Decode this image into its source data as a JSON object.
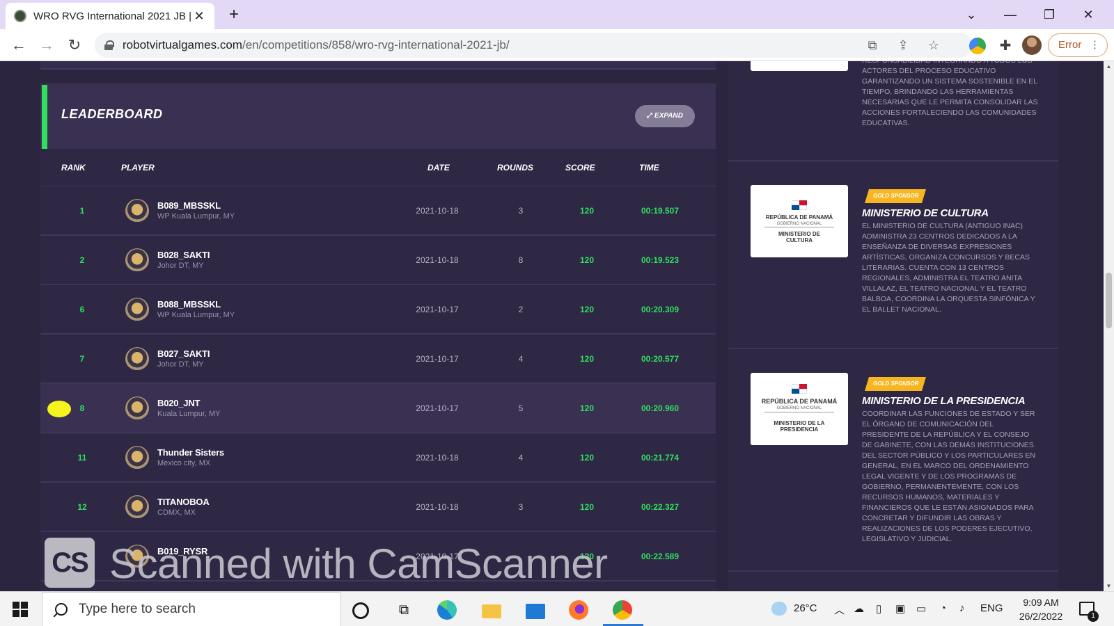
{
  "browser": {
    "tab_title": "WRO RVG International 2021 JB |",
    "tab_close": "✕",
    "new_tab": "+",
    "url_host": "robotvirtualgames.com",
    "url_path": "/en/competitions/858/wro-rvg-international-2021-jb/",
    "error_chip": "Error",
    "window_controls": [
      "⌄",
      "—",
      "❐",
      "✕"
    ]
  },
  "leaderboard": {
    "title": "LEADERBOARD",
    "expand_label": "EXPAND",
    "columns": {
      "rank": "RANK",
      "player": "PLAYER",
      "date": "DATE",
      "rounds": "ROUNDS",
      "score": "SCORE",
      "time": "TIME"
    },
    "rows": [
      {
        "rank": "1",
        "name": "B089_MBSSKL",
        "location": "WP Kuala Lumpur, MY",
        "date": "2021-10-18",
        "rounds": "3",
        "score": "120",
        "time": "00:19.507"
      },
      {
        "rank": "2",
        "name": "B028_SAKTI",
        "location": "Johor DT, MY",
        "date": "2021-10-18",
        "rounds": "8",
        "score": "120",
        "time": "00:19.523"
      },
      {
        "rank": "6",
        "name": "B088_MBSSKL",
        "location": "WP Kuala Lumpur, MY",
        "date": "2021-10-17",
        "rounds": "2",
        "score": "120",
        "time": "00:20.309"
      },
      {
        "rank": "7",
        "name": "B027_SAKTI",
        "location": "Johor DT, MY",
        "date": "2021-10-17",
        "rounds": "4",
        "score": "120",
        "time": "00:20.577"
      },
      {
        "rank": "8",
        "name": "B020_JNT",
        "location": "Kuala Lumpur, MY",
        "date": "2021-10-17",
        "rounds": "5",
        "score": "120",
        "time": "00:20.960"
      },
      {
        "rank": "11",
        "name": "Thunder Sisters",
        "location": "Mexico city, MX",
        "date": "2021-10-18",
        "rounds": "4",
        "score": "120",
        "time": "00:21.774"
      },
      {
        "rank": "12",
        "name": "TITANOBOA",
        "location": "CDMX, MX",
        "date": "2021-10-18",
        "rounds": "3",
        "score": "120",
        "time": "00:22.327"
      },
      {
        "rank": "",
        "name": "B019_RYSR",
        "location": "",
        "date": "2021-10-17",
        "rounds": "",
        "score": "120",
        "time": "00:22.589"
      }
    ]
  },
  "sponsors": {
    "top_fragment": "RESPONSABILIDAD INTEGRANDO A TODOS LOS ACTORES DEL PROCESO EDUCATIVO GARANTIZANDO UN SISTEMA SOSTENIBLE EN EL TIEMPO, BRINDANDO LAS HERRAMIENTAS NECESARIAS QUE LE PERMITA CONSOLIDAR LAS ACCIONES FORTALECIENDO LAS COMUNIDADES EDUCATIVAS.",
    "items": [
      {
        "badge": "GOLD SPONSOR",
        "name": "MINISTERIO DE CULTURA",
        "logo_title": "REPÚBLICA DE PANAMÁ",
        "logo_sub": "GOBIERNO NACIONAL",
        "logo_ministry": "MINISTERIO DE CULTURA",
        "description": "EL MINISTERIO DE CULTURA (ANTIGUO INAC) ADMINISTRA 23 CENTROS DEDICADOS A LA ENSEÑANZA DE DIVERSAS EXPRESIONES ARTÍSTICAS, ORGANIZA CONCURSOS Y BECAS LITERARIAS. CUENTA CON 13 CENTROS REGIONALES, ADMINISTRA EL TEATRO ANITA VILLALAZ, EL TEATRO NACIONAL Y EL TEATRO BALBOA, COORDINA LA ORQUESTA SINFÓNICA Y EL BALLET NACIONAL."
      },
      {
        "badge": "GOLD SPONSOR",
        "name": "MINISTERIO DE LA PRESIDENCIA",
        "logo_title": "REPÚBLICA DE PANAMÁ",
        "logo_sub": "GOBIERNO NACIONAL",
        "logo_ministry": "MINISTERIO DE LA PRESIDENCIA",
        "description": "COORDINAR LAS FUNCIONES DE ESTADO Y SER EL ÓRGANO DE COMUNICACIÓN DEL PRESIDENTE DE LA REPÚBLICA Y EL CONSEJO DE GABINETE, CON LAS DEMÁS INSTITUCIONES DEL SECTOR PÚBLICO Y LOS PARTICULARES EN GENERAL, EN EL MARCO DEL ORDENAMIENTO LEGAL VIGENTE Y DE LOS PROGRAMAS DE GOBIERNO, PERMANENTEMENTE, CON LOS RECURSOS HUMANOS, MATERIALES Y FINANCIEROS QUE LE ESTÁN ASIGNADOS PARA CONCRETAR Y DIFUNDIR LAS OBRAS Y REALIZACIONES DE LOS PODERES EJECUTIVO, LEGISLATIVO Y JUDICIAL."
      }
    ]
  },
  "watermark": {
    "logo": "CS",
    "text": "Scanned with CamScanner"
  },
  "taskbar": {
    "search_placeholder": "Type here to search",
    "temperature": "26°C",
    "language": "ENG",
    "time": "9:09 AM",
    "date": "26/2/2022",
    "notification_count": "1"
  },
  "colors": {
    "accent_green": "#2fe05f",
    "page_bg": "#2b2540",
    "card_bg": "#2f2845",
    "gold_badge": "#f7b520",
    "highlight_marker": "#f6f41e"
  }
}
